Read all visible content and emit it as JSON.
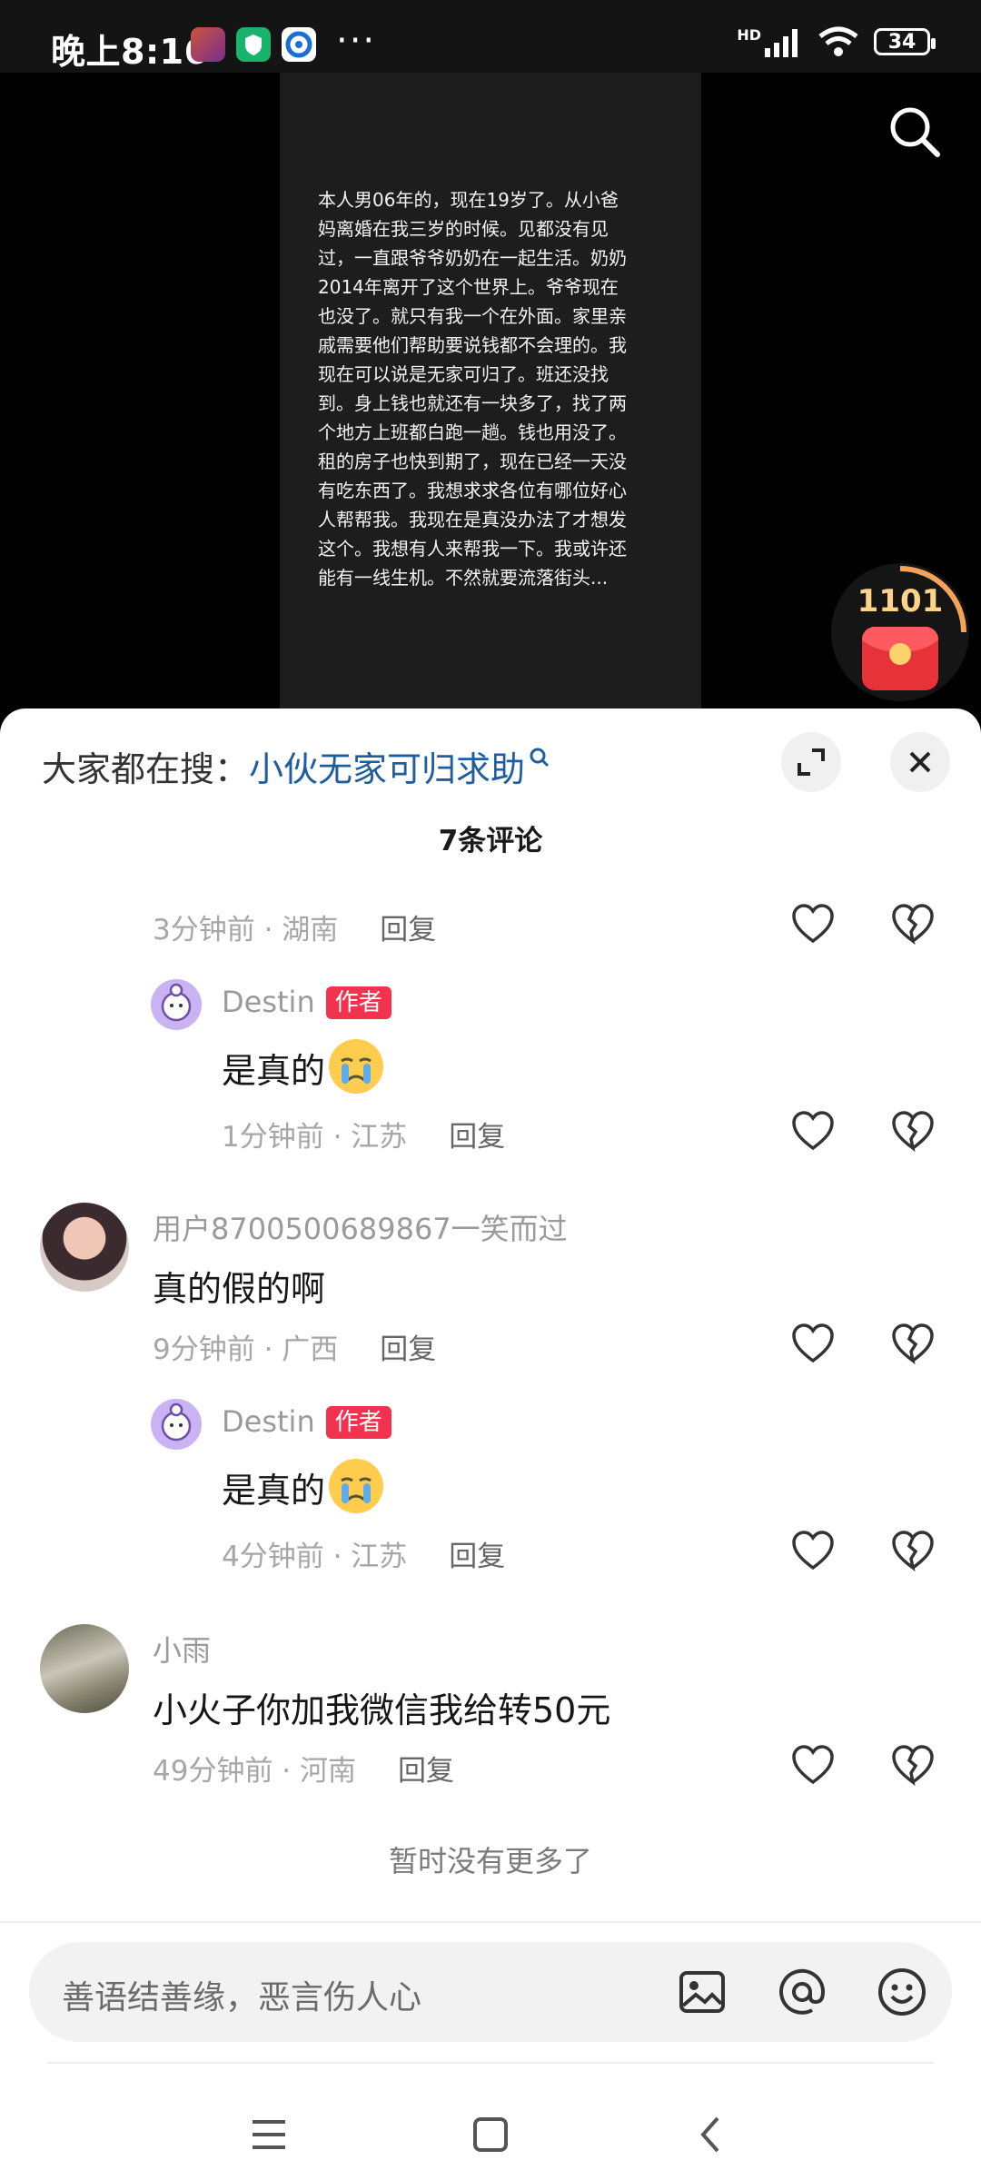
{
  "status_bar": {
    "time": "晚上8:16",
    "more": "···",
    "network": "HD",
    "battery": "34"
  },
  "video": {
    "caption": "本人男06年的，现在19岁了。从小爸\n妈离婚在我三岁的时候。见都没有见\n过，一直跟爷爷奶奶在一起生活。奶奶\n2014年离开了这个世界上。爷爷现在\n也没了。就只有我一个在外面。家里亲\n戚需要他们帮助要说钱都不会理的。我\n现在可以说是无家可归了。班还没找\n到。身上钱也就还有一块多了，找了两\n个地方上班都白跑一趟。钱也用没了。\n租的房子也快到期了，现在已经一天没\n有吃东西了。我想求求各位有哪位好心\n人帮帮我。我现在是真没办法了才想发\n这个。我想有人来帮我一下。我或许还\n能有一线生机。不然就要流落街头...",
    "reward_count": "1101"
  },
  "comments_sheet": {
    "hot_search_prefix": "大家都在搜：",
    "hot_search_term": "小伙无家可归求助",
    "title": "7条评论",
    "comments": [
      {
        "time": "3分钟前",
        "location": "湖南",
        "reply_label": "回复"
      },
      {
        "username": "Destin",
        "tag": "作者",
        "text": "是真的",
        "time": "1分钟前",
        "location": "江苏",
        "reply_label": "回复"
      },
      {
        "username": "用户8700500689867一笑而过",
        "text": "真的假的啊",
        "time": "9分钟前",
        "location": "广西",
        "reply_label": "回复"
      },
      {
        "username": "Destin",
        "tag": "作者",
        "text": "是真的",
        "time": "4分钟前",
        "location": "江苏",
        "reply_label": "回复"
      },
      {
        "username": "小雨",
        "text": "小火子你加我微信我给转50元",
        "time": "49分钟前",
        "location": "河南",
        "reply_label": "回复"
      }
    ],
    "no_more": "暂时没有更多了",
    "input_placeholder": "善语结善缘，恶言伤人心"
  },
  "colors": {
    "author_tag": "#f2324e",
    "hot_search_link": "#1f5e9e",
    "reward_red": "#e8323a"
  }
}
